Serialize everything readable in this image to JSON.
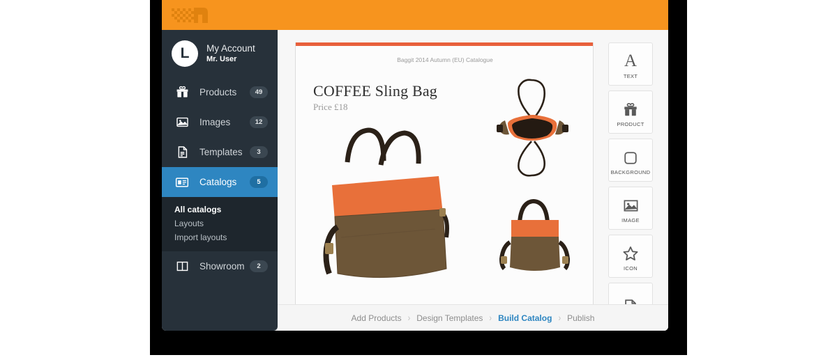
{
  "brand": {
    "logo_icon": "checkered-flag-logo",
    "bar_color": "#f7941e"
  },
  "sidebar": {
    "account": {
      "avatar_letter": "L",
      "name": "My Account",
      "subtitle": "Mr. User"
    },
    "items": [
      {
        "icon": "gift-icon",
        "label": "Products",
        "badge": "49",
        "active": false
      },
      {
        "icon": "image-icon",
        "label": "Images",
        "badge": "12",
        "active": false
      },
      {
        "icon": "document-icon",
        "label": "Templates",
        "badge": "3",
        "active": false
      },
      {
        "icon": "catalog-icon",
        "label": "Catalogs",
        "badge": "5",
        "active": true
      },
      {
        "icon": "columns-icon",
        "label": "Showroom",
        "badge": "2",
        "active": false
      }
    ],
    "submenu": [
      {
        "label": "All catalogs",
        "selected": true
      },
      {
        "label": "Layouts",
        "selected": false
      },
      {
        "label": "Import layouts",
        "selected": false
      }
    ]
  },
  "canvas": {
    "accent_color": "#e8603c",
    "header_text": "Baggit 2014 Autumn (EU) Catalogue",
    "title": "COFFEE Sling Bag",
    "price": "Price £18",
    "product": {
      "name": "COFFEE Sling Bag",
      "body_color": "#6d5638",
      "accent_color": "#e8703a",
      "strap_color": "#2b2118"
    }
  },
  "toolbar": {
    "tools": [
      {
        "icon": "text-icon",
        "label": "TEXT"
      },
      {
        "icon": "gift-icon",
        "label": "PRODUCT"
      },
      {
        "icon": "square-icon",
        "label": "BACKGROUND"
      },
      {
        "icon": "image-icon",
        "label": "IMAGE"
      },
      {
        "icon": "star-icon",
        "label": "ICON"
      },
      {
        "icon": "page-icon",
        "label": ""
      }
    ]
  },
  "footer": {
    "steps": [
      {
        "label": "Add Products",
        "current": false
      },
      {
        "label": "Design Templates",
        "current": false
      },
      {
        "label": "Build Catalog",
        "current": true
      },
      {
        "label": "Publish",
        "current": false
      }
    ],
    "separator": "›"
  },
  "colors": {
    "orange": "#f7941e",
    "blue": "#2e86c1",
    "sidebar": "#27313a",
    "submenu": "#1e262d"
  }
}
